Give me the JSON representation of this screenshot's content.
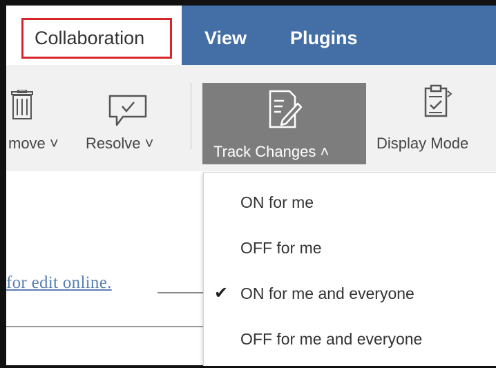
{
  "tabs": {
    "collaboration": "Collaboration",
    "view": "View",
    "plugins": "Plugins"
  },
  "ribbon": {
    "remove_label": "move ˅",
    "resolve_label": "Resolve ˅",
    "track_changes_label": "Track Changes ˄",
    "display_mode_label": "Display Mode"
  },
  "document": {
    "link_text": "for edit online."
  },
  "track_menu": {
    "items": [
      {
        "label": "ON for me",
        "checked": false
      },
      {
        "label": "OFF for me",
        "checked": false
      },
      {
        "label": "ON for me and everyone",
        "checked": true
      },
      {
        "label": "OFF for me and everyone",
        "checked": false
      }
    ],
    "check_glyph": "✔"
  },
  "colors": {
    "tab_bar": "#446ea6",
    "active_outline": "#d7262b",
    "track_button_active": "#7d7d7d"
  }
}
